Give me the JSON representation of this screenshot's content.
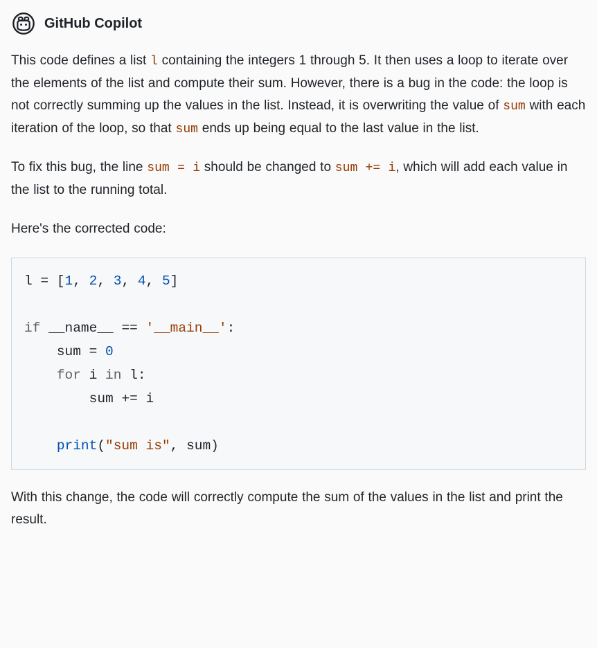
{
  "header": {
    "title": "GitHub Copilot"
  },
  "paragraphs": {
    "p1a": "This code defines a list ",
    "p1_code1": "l",
    "p1b": " containing the integers 1 through 5. It then uses a loop to iterate over the elements of the list and compute their sum. However, there is a bug in the code: the loop is not correctly summing up the values in the list. Instead, it is overwriting the value of ",
    "p1_code2": "sum",
    "p1c": " with each iteration of the loop, so that ",
    "p1_code3": "sum",
    "p1d": " ends up being equal to the last value in the list.",
    "p2a": "To fix this bug, the line ",
    "p2_code1": "sum = i",
    "p2b": " should be changed to ",
    "p2_code2": "sum += i",
    "p2c": ", which will add each value in the list to the running total.",
    "p3": "Here's the corrected code:",
    "p4": "With this change, the code will correctly compute the sum of the values in the list and print the result."
  },
  "code": {
    "line1": {
      "var_l": "l",
      "space1": " ",
      "eq": "=",
      "space2": " ",
      "lbracket": "[",
      "n1": "1",
      "c1": ",",
      "s1": " ",
      "n2": "2",
      "c2": ",",
      "s2": " ",
      "n3": "3",
      "c3": ",",
      "s3": " ",
      "n4": "4",
      "c4": ",",
      "s4": " ",
      "n5": "5",
      "rbracket": "]"
    },
    "blank1": "",
    "line3": {
      "kw_if": "if",
      "space1": " ",
      "dunder_name": "__name__",
      "space2": " ",
      "eqeq": "==",
      "space3": " ",
      "str_main": "'__main__'",
      "colon": ":"
    },
    "line4": {
      "indent": "    ",
      "sum": "sum",
      "space1": " ",
      "eq": "=",
      "space2": " ",
      "zero": "0"
    },
    "line5": {
      "indent": "    ",
      "kw_for": "for",
      "space1": " ",
      "var_i": "i",
      "space2": " ",
      "kw_in": "in",
      "space3": " ",
      "var_l": "l",
      "colon": ":"
    },
    "line6": {
      "indent": "        ",
      "sum": "sum",
      "space1": " ",
      "pluseq": "+=",
      "space2": " ",
      "var_i": "i"
    },
    "blank2": "",
    "line8": {
      "indent": "    ",
      "print": "print",
      "lparen": "(",
      "str": "\"sum is\"",
      "comma": ",",
      "space": " ",
      "sum": "sum",
      "rparen": ")"
    }
  }
}
